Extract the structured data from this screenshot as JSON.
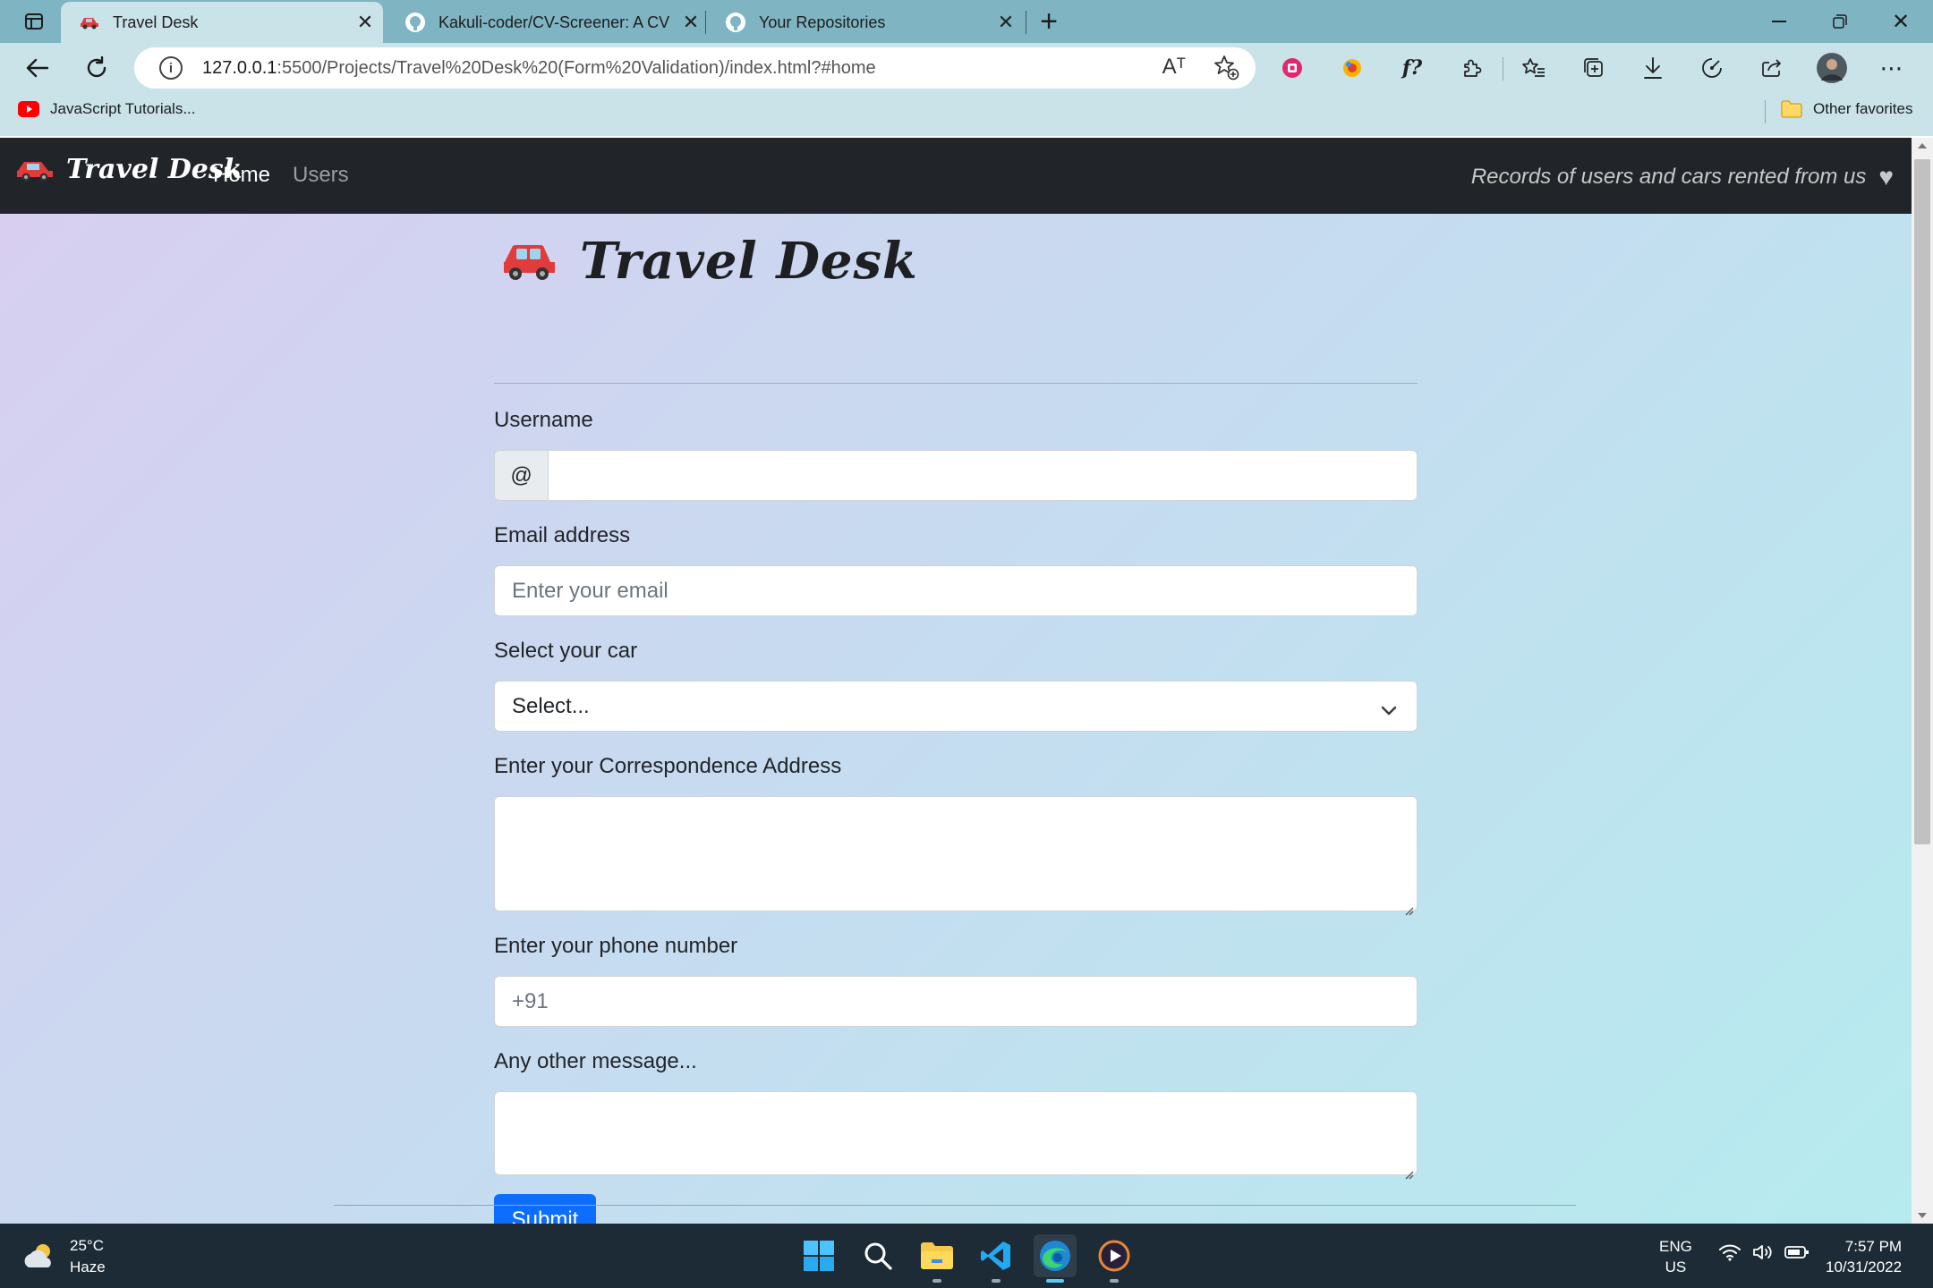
{
  "browser": {
    "tabs": [
      {
        "title": "Travel Desk",
        "active": true,
        "icon": "car-emoji-icon"
      },
      {
        "title": "Kakuli-coder/CV-Screener: A CV",
        "active": false,
        "icon": "github-icon"
      },
      {
        "title": "Your Repositories",
        "active": false,
        "icon": "github-icon"
      }
    ],
    "new_tab_glyph": "+",
    "address": {
      "host": "127.0.0.1",
      "path": ":5500/Projects/Travel%20Desk%20(Form%20Validation)/index.html?#home"
    },
    "favorites": {
      "item1": "JavaScript Tutorials...",
      "other": "Other favorites"
    },
    "icons": {
      "read_aloud": "Aᵀ",
      "profile_fx": "f?"
    }
  },
  "site": {
    "brand": "Travel Desk",
    "nav": {
      "home": "Home",
      "users": "Users"
    },
    "tagline": "Records of users and cars rented from us",
    "heart": "♥"
  },
  "form": {
    "heading": "Travel Desk",
    "username": {
      "label": "Username",
      "prefix": "@",
      "value": ""
    },
    "email": {
      "label": "Email address",
      "placeholder": "Enter your email"
    },
    "car": {
      "label": "Select your car",
      "selected": "Select..."
    },
    "address": {
      "label": "Enter your Correspondence Address",
      "value": ""
    },
    "phone": {
      "label": "Enter your phone number",
      "placeholder": "+91"
    },
    "message": {
      "label": "Any other message...",
      "value": ""
    },
    "submit": "Submit"
  },
  "taskbar": {
    "weather": {
      "temp": "25°C",
      "condition": "Haze"
    },
    "lang": {
      "line1": "ENG",
      "line2": "US"
    },
    "clock": {
      "time": "7:57 PM",
      "date": "10/31/2022"
    }
  },
  "colors": {
    "navbar_bg": "#212529",
    "button_primary": "#0d6efd",
    "browser_frame": "#7fb4c2",
    "taskbar_bg": "#1c2b35"
  }
}
